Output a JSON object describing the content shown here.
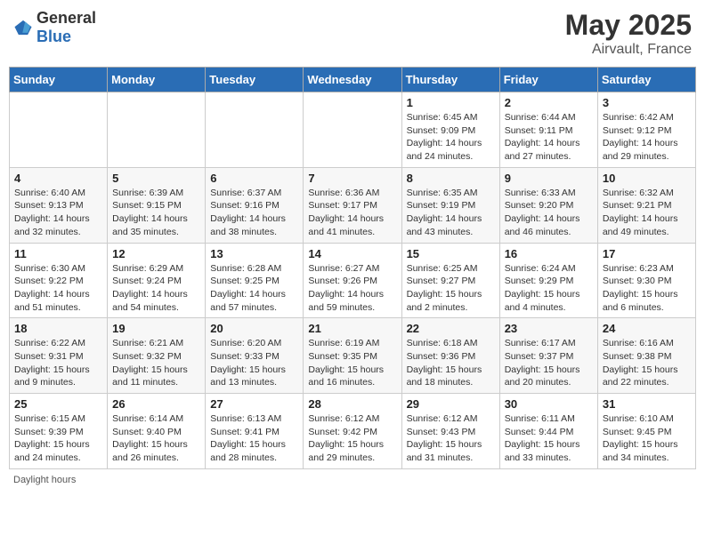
{
  "logo": {
    "general": "General",
    "blue": "Blue"
  },
  "header": {
    "month_year": "May 2025",
    "location": "Airvault, France"
  },
  "weekdays": [
    "Sunday",
    "Monday",
    "Tuesday",
    "Wednesday",
    "Thursday",
    "Friday",
    "Saturday"
  ],
  "weeks": [
    [
      {
        "day": "",
        "info": ""
      },
      {
        "day": "",
        "info": ""
      },
      {
        "day": "",
        "info": ""
      },
      {
        "day": "",
        "info": ""
      },
      {
        "day": "1",
        "info": "Sunrise: 6:45 AM\nSunset: 9:09 PM\nDaylight: 14 hours and 24 minutes."
      },
      {
        "day": "2",
        "info": "Sunrise: 6:44 AM\nSunset: 9:11 PM\nDaylight: 14 hours and 27 minutes."
      },
      {
        "day": "3",
        "info": "Sunrise: 6:42 AM\nSunset: 9:12 PM\nDaylight: 14 hours and 29 minutes."
      }
    ],
    [
      {
        "day": "4",
        "info": "Sunrise: 6:40 AM\nSunset: 9:13 PM\nDaylight: 14 hours and 32 minutes."
      },
      {
        "day": "5",
        "info": "Sunrise: 6:39 AM\nSunset: 9:15 PM\nDaylight: 14 hours and 35 minutes."
      },
      {
        "day": "6",
        "info": "Sunrise: 6:37 AM\nSunset: 9:16 PM\nDaylight: 14 hours and 38 minutes."
      },
      {
        "day": "7",
        "info": "Sunrise: 6:36 AM\nSunset: 9:17 PM\nDaylight: 14 hours and 41 minutes."
      },
      {
        "day": "8",
        "info": "Sunrise: 6:35 AM\nSunset: 9:19 PM\nDaylight: 14 hours and 43 minutes."
      },
      {
        "day": "9",
        "info": "Sunrise: 6:33 AM\nSunset: 9:20 PM\nDaylight: 14 hours and 46 minutes."
      },
      {
        "day": "10",
        "info": "Sunrise: 6:32 AM\nSunset: 9:21 PM\nDaylight: 14 hours and 49 minutes."
      }
    ],
    [
      {
        "day": "11",
        "info": "Sunrise: 6:30 AM\nSunset: 9:22 PM\nDaylight: 14 hours and 51 minutes."
      },
      {
        "day": "12",
        "info": "Sunrise: 6:29 AM\nSunset: 9:24 PM\nDaylight: 14 hours and 54 minutes."
      },
      {
        "day": "13",
        "info": "Sunrise: 6:28 AM\nSunset: 9:25 PM\nDaylight: 14 hours and 57 minutes."
      },
      {
        "day": "14",
        "info": "Sunrise: 6:27 AM\nSunset: 9:26 PM\nDaylight: 14 hours and 59 minutes."
      },
      {
        "day": "15",
        "info": "Sunrise: 6:25 AM\nSunset: 9:27 PM\nDaylight: 15 hours and 2 minutes."
      },
      {
        "day": "16",
        "info": "Sunrise: 6:24 AM\nSunset: 9:29 PM\nDaylight: 15 hours and 4 minutes."
      },
      {
        "day": "17",
        "info": "Sunrise: 6:23 AM\nSunset: 9:30 PM\nDaylight: 15 hours and 6 minutes."
      }
    ],
    [
      {
        "day": "18",
        "info": "Sunrise: 6:22 AM\nSunset: 9:31 PM\nDaylight: 15 hours and 9 minutes."
      },
      {
        "day": "19",
        "info": "Sunrise: 6:21 AM\nSunset: 9:32 PM\nDaylight: 15 hours and 11 minutes."
      },
      {
        "day": "20",
        "info": "Sunrise: 6:20 AM\nSunset: 9:33 PM\nDaylight: 15 hours and 13 minutes."
      },
      {
        "day": "21",
        "info": "Sunrise: 6:19 AM\nSunset: 9:35 PM\nDaylight: 15 hours and 16 minutes."
      },
      {
        "day": "22",
        "info": "Sunrise: 6:18 AM\nSunset: 9:36 PM\nDaylight: 15 hours and 18 minutes."
      },
      {
        "day": "23",
        "info": "Sunrise: 6:17 AM\nSunset: 9:37 PM\nDaylight: 15 hours and 20 minutes."
      },
      {
        "day": "24",
        "info": "Sunrise: 6:16 AM\nSunset: 9:38 PM\nDaylight: 15 hours and 22 minutes."
      }
    ],
    [
      {
        "day": "25",
        "info": "Sunrise: 6:15 AM\nSunset: 9:39 PM\nDaylight: 15 hours and 24 minutes."
      },
      {
        "day": "26",
        "info": "Sunrise: 6:14 AM\nSunset: 9:40 PM\nDaylight: 15 hours and 26 minutes."
      },
      {
        "day": "27",
        "info": "Sunrise: 6:13 AM\nSunset: 9:41 PM\nDaylight: 15 hours and 28 minutes."
      },
      {
        "day": "28",
        "info": "Sunrise: 6:12 AM\nSunset: 9:42 PM\nDaylight: 15 hours and 29 minutes."
      },
      {
        "day": "29",
        "info": "Sunrise: 6:12 AM\nSunset: 9:43 PM\nDaylight: 15 hours and 31 minutes."
      },
      {
        "day": "30",
        "info": "Sunrise: 6:11 AM\nSunset: 9:44 PM\nDaylight: 15 hours and 33 minutes."
      },
      {
        "day": "31",
        "info": "Sunrise: 6:10 AM\nSunset: 9:45 PM\nDaylight: 15 hours and 34 minutes."
      }
    ]
  ],
  "footer": "Daylight hours"
}
